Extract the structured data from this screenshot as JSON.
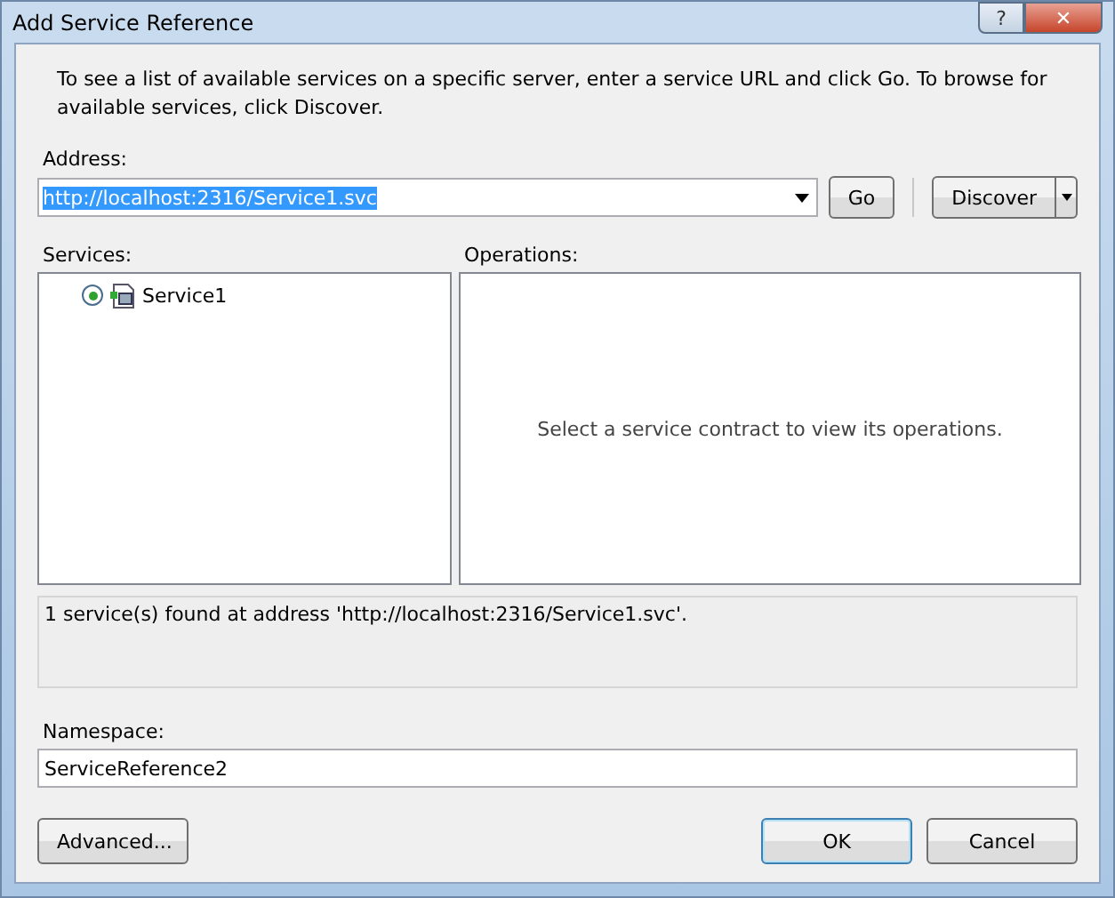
{
  "window": {
    "title": "Add Service Reference",
    "help_button": "?",
    "close_button": "✕"
  },
  "description": "To see a list of available services on a specific server, enter a service URL and click Go. To browse for available services, click Discover.",
  "address": {
    "label": "Address:",
    "value": "http://localhost:2316/Service1.svc",
    "text_selected": true
  },
  "go_button": "Go",
  "discover_button": "Discover",
  "services": {
    "label": "Services:",
    "items": [
      {
        "label": "Service1",
        "selected": true
      }
    ]
  },
  "operations": {
    "label": "Operations:",
    "hint": "Select a service contract to view its operations."
  },
  "status": "1 service(s) found at address 'http://localhost:2316/Service1.svc'.",
  "namespace": {
    "label": "Namespace:",
    "value": "ServiceReference2"
  },
  "buttons": [
    {
      "label": "Advanced...",
      "kind": "secondary"
    },
    {
      "label": "OK",
      "kind": "default"
    },
    {
      "label": "Cancel",
      "kind": "cancel"
    }
  ]
}
